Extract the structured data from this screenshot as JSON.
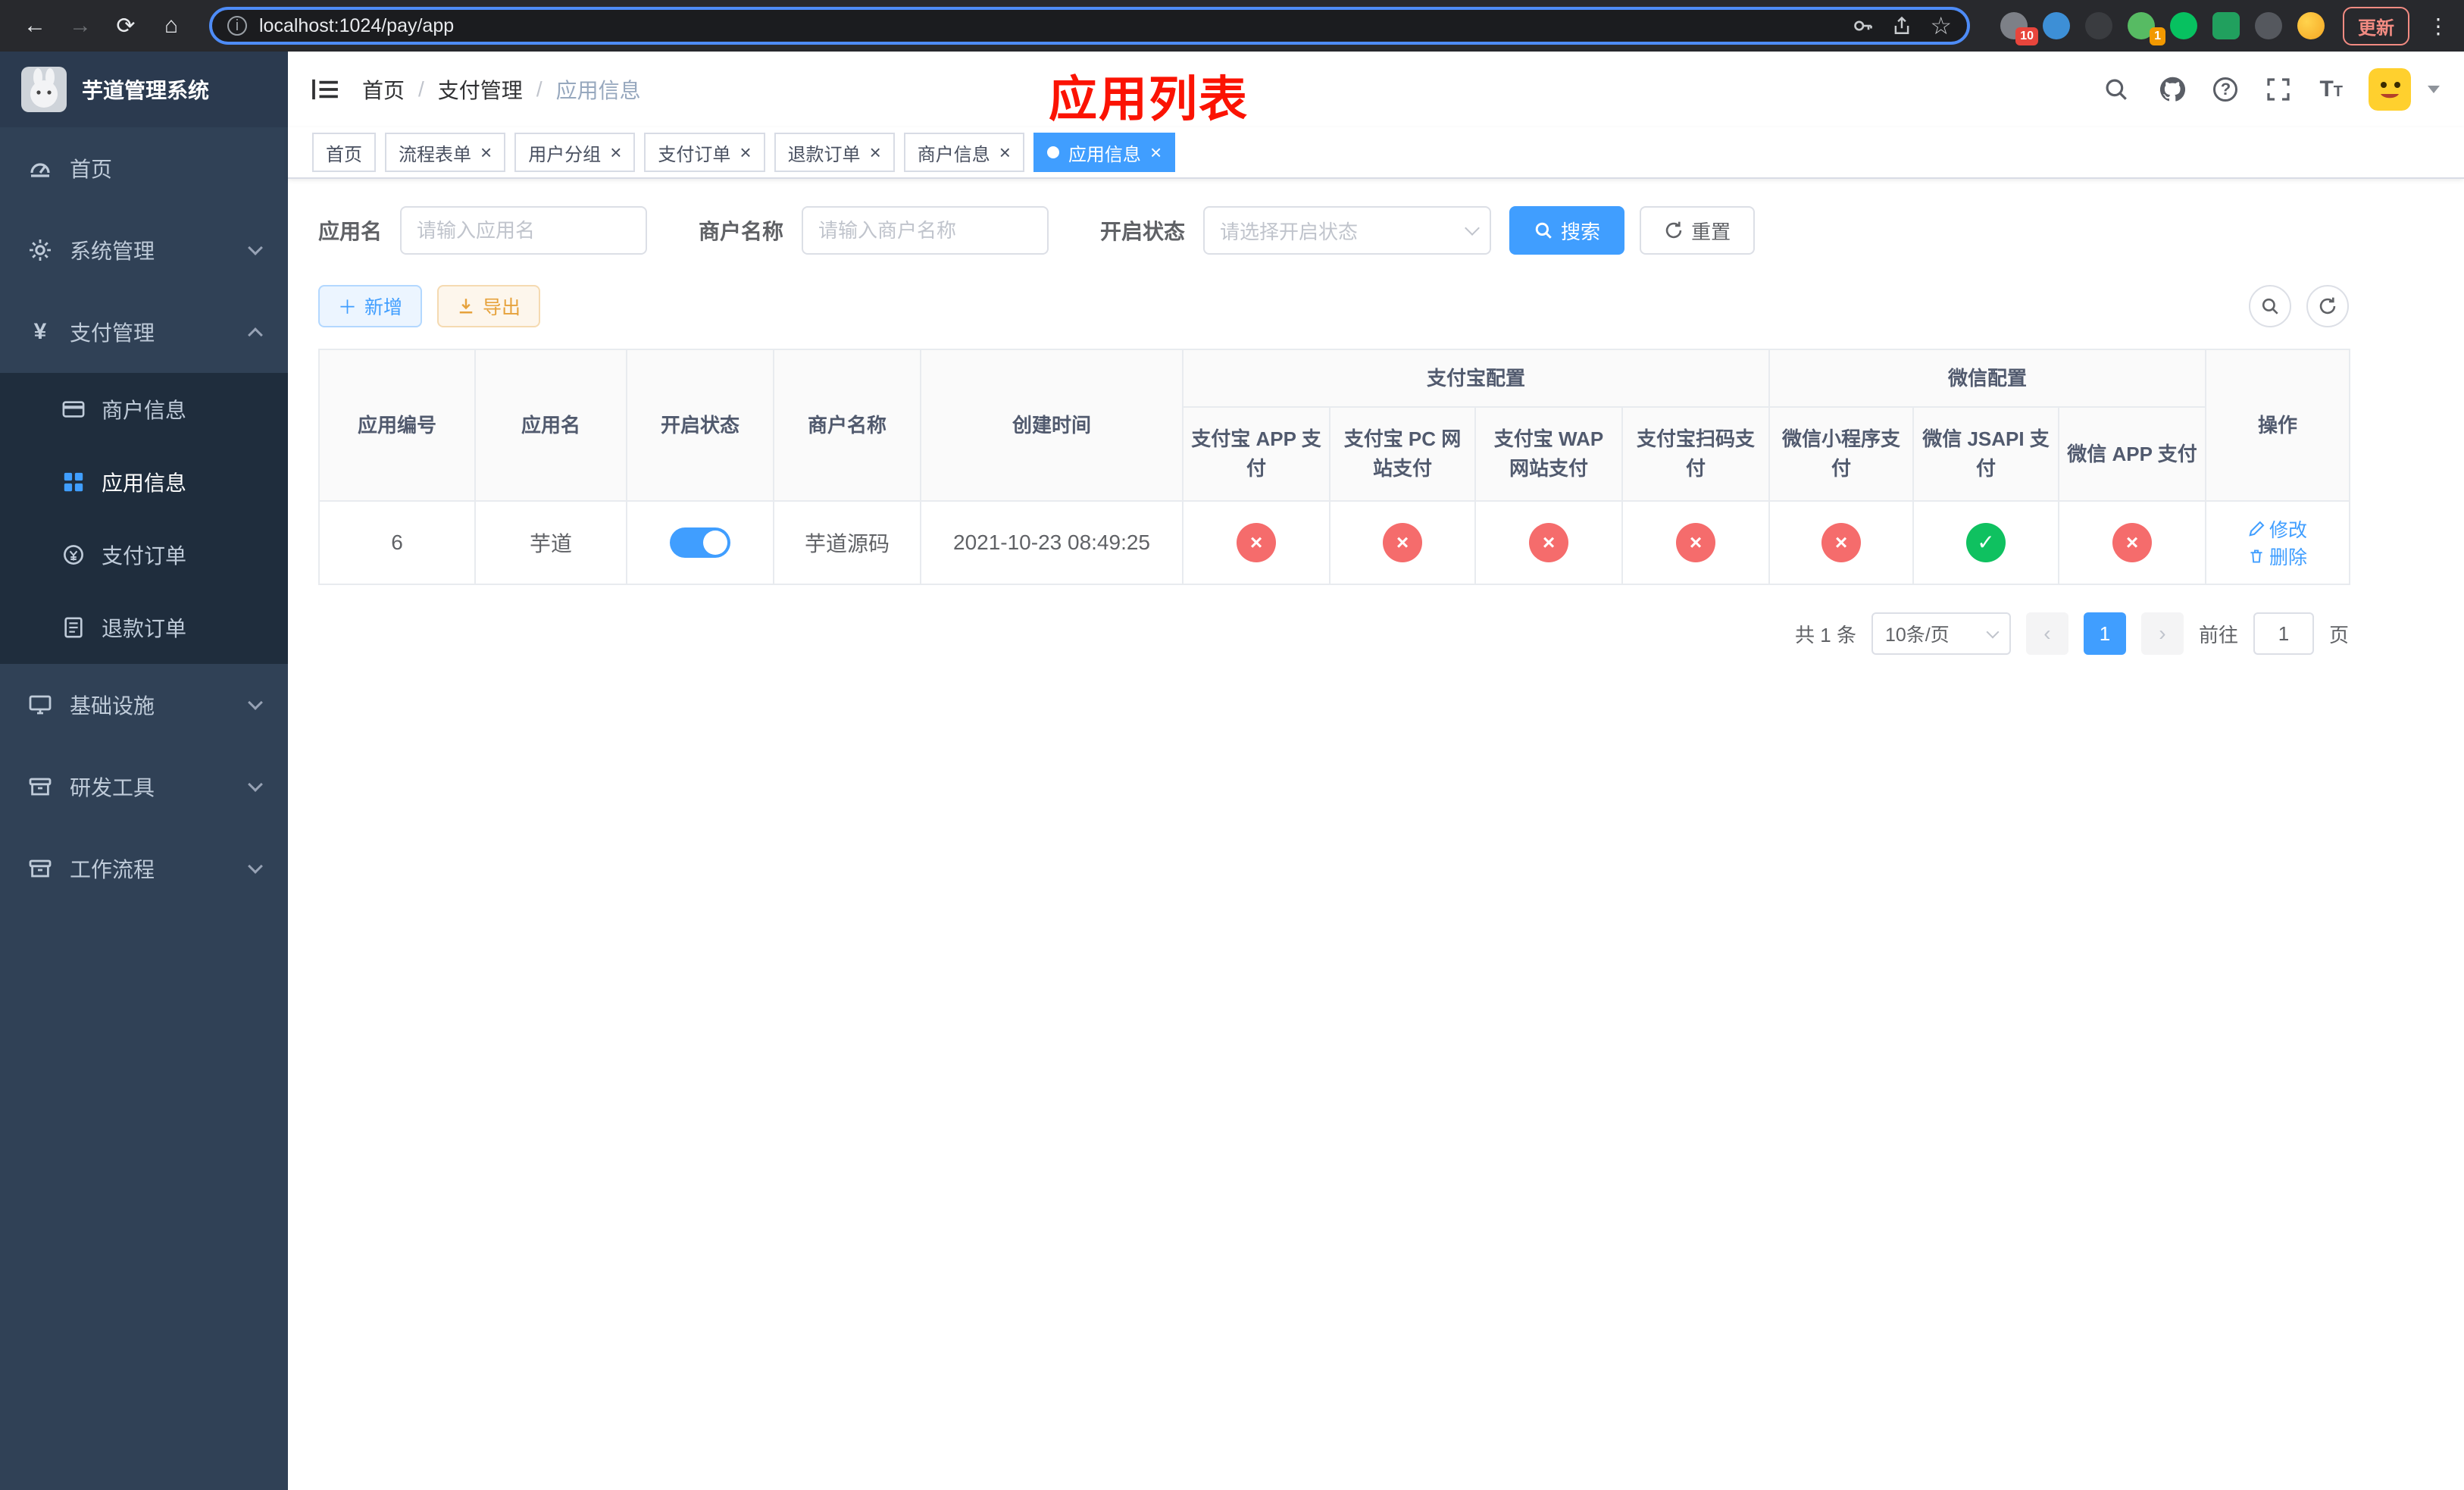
{
  "colors": {
    "accent": "#409eff",
    "danger": "#f56c6c",
    "success": "#0fc160",
    "annotation_red": "#fb1303",
    "sidebar_bg": "#304156",
    "submenu_bg": "#1f2d3d"
  },
  "browser": {
    "url": "localhost:1024/pay/app",
    "update_label": "更新",
    "ext_badge_1": "10",
    "ext_badge_2": "1"
  },
  "sidebar": {
    "title": "芋道管理系统",
    "items": [
      {
        "label": "首页"
      },
      {
        "label": "系统管理"
      },
      {
        "label": "支付管理",
        "children": [
          {
            "label": "商户信息"
          },
          {
            "label": "应用信息"
          },
          {
            "label": "支付订单"
          },
          {
            "label": "退款订单"
          }
        ]
      },
      {
        "label": "基础设施"
      },
      {
        "label": "研发工具"
      },
      {
        "label": "工作流程"
      }
    ]
  },
  "navbar": {
    "breadcrumb": [
      "首页",
      "支付管理",
      "应用信息"
    ],
    "separator": "/",
    "annotation": "应用列表"
  },
  "ui": {
    "close": "×"
  },
  "tabs": [
    {
      "label": "首页"
    },
    {
      "label": "流程表单"
    },
    {
      "label": "用户分组"
    },
    {
      "label": "支付订单"
    },
    {
      "label": "退款订单"
    },
    {
      "label": "商户信息"
    },
    {
      "label": "应用信息"
    }
  ],
  "filters": {
    "app_name_label": "应用名",
    "app_name_placeholder": "请输入应用名",
    "merchant_label": "商户名称",
    "merchant_placeholder": "请输入商户名称",
    "status_label": "开启状态",
    "status_placeholder": "请选择开启状态",
    "search_label": "搜索",
    "reset_label": "重置"
  },
  "toolbar": {
    "add_label": "新增",
    "export_label": "导出"
  },
  "table": {
    "simple_columns": [
      "应用编号",
      "应用名",
      "开启状态",
      "商户名称",
      "创建时间"
    ],
    "alipay_group": "支付宝配置",
    "wechat_group": "微信配置",
    "alipay_columns": [
      "支付宝 APP 支付",
      "支付宝 PC 网站支付",
      "支付宝 WAP 网站支付",
      "支付宝扫码支付"
    ],
    "wechat_columns": [
      "微信小程序支付",
      "微信 JSAPI 支付",
      "微信 APP 支付"
    ],
    "action_column": "操作",
    "rows": [
      {
        "app_id": "6",
        "app_name": "芋道",
        "enabled": true,
        "merchant_name": "芋道源码",
        "create_time": "2021-10-23 08:49:25",
        "alipay_app": false,
        "alipay_pc": false,
        "alipay_wap": false,
        "alipay_scan": false,
        "wechat_mini": false,
        "wechat_jsapi": true,
        "wechat_app": false
      }
    ],
    "actions": {
      "edit": "修改",
      "delete": "删除"
    },
    "glyphs": {
      "ok": "✓",
      "no": "×"
    }
  },
  "pagination": {
    "total": "共 1 条",
    "page_size": "10条/页",
    "page": "1",
    "prev": "‹",
    "next": "›",
    "goto_label": "前往",
    "goto_value": "1",
    "unit": "页"
  }
}
